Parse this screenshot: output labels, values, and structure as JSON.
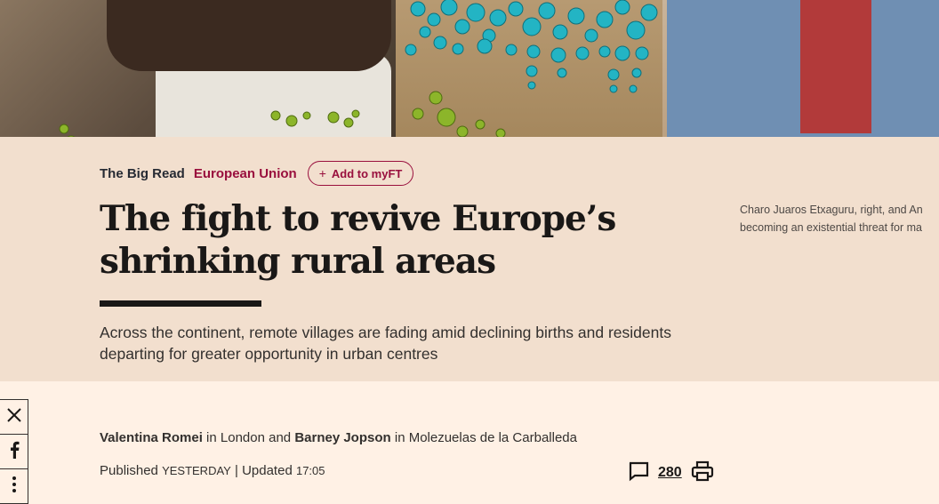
{
  "article": {
    "kicker": "The Big Read",
    "topic": "European Union",
    "add_button": "Add to myFT",
    "headline_line1": "The fight to revive Europe’s",
    "headline_line2": "shrinking rural areas",
    "standfirst_line1": "Across the continent, remote villages are fading amid declining births and residents",
    "standfirst_line2": "departing for greater opportunity in urban centres",
    "caption_line1": "Charo Juaros Etxaguru, right, and An",
    "caption_line2": "becoming an existential threat for ma"
  },
  "byline": {
    "author1": "Valentina Romei",
    "loc1": " in London and ",
    "author2": "Barney Jopson",
    "loc2": " in Molezuelas de la Carballeda"
  },
  "published": {
    "label": "Published ",
    "when": "YESTERDAY",
    "updated": " | Updated ",
    "time": "17:05"
  },
  "comments": {
    "count": "280"
  },
  "share": {
    "icons": [
      "x-icon",
      "facebook-icon",
      "more-icon"
    ]
  },
  "colors": {
    "accent": "#990f3d",
    "background": "#fff1e5",
    "panel": "#f2dfce"
  }
}
